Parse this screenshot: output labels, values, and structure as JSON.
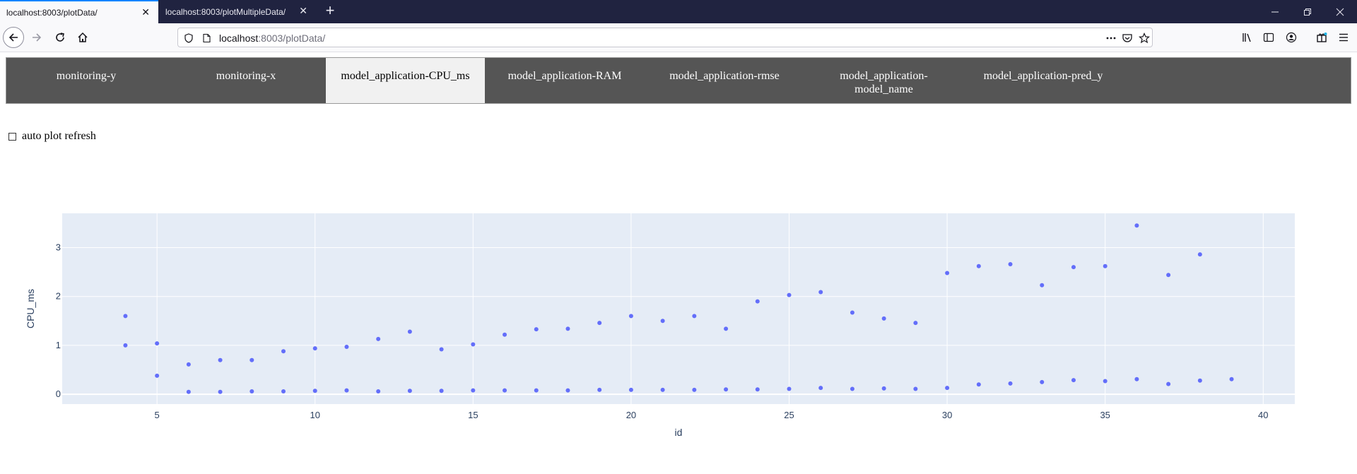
{
  "browser": {
    "tabs": [
      {
        "title": "localhost:8003/plotData/",
        "active": true
      },
      {
        "title": "localhost:8003/plotMultipleData/",
        "active": false
      }
    ],
    "address": {
      "host": "localhost",
      "rest": ":8003/plotData/"
    }
  },
  "page": {
    "tabs": [
      {
        "label": "monitoring-y",
        "active": false
      },
      {
        "label": "monitoring-x",
        "active": false
      },
      {
        "label": "model_application-CPU_ms",
        "active": true
      },
      {
        "label": "model_application-RAM",
        "active": false
      },
      {
        "label": "model_application-rmse",
        "active": false
      },
      {
        "label": "model_application-\nmodel_name",
        "active": false
      },
      {
        "label": "model_application-pred_y",
        "active": false
      }
    ],
    "auto_refresh_label": "auto plot refresh"
  },
  "colors": {
    "accent": "#0a84ff",
    "marker": "#636efa",
    "plot_bg": "#e5ecf6",
    "tab_bg": "#555555",
    "tab_active_bg": "#f1f1f1"
  },
  "chart_data": {
    "type": "scatter",
    "xlabel": "id",
    "ylabel": "CPU_ms",
    "xlim": [
      2,
      41
    ],
    "ylim": [
      -0.2,
      3.7
    ],
    "xticks": [
      5,
      10,
      15,
      20,
      25,
      30,
      35,
      40
    ],
    "yticks": [
      0,
      1,
      2,
      3
    ],
    "grid": true,
    "series": [
      {
        "points": [
          [
            4,
            1.6
          ],
          [
            4,
            1.0
          ],
          [
            5,
            1.04
          ],
          [
            5,
            0.38
          ],
          [
            6,
            0.61
          ],
          [
            6,
            0.05
          ],
          [
            7,
            0.7
          ],
          [
            7,
            0.05
          ],
          [
            8,
            0.7
          ],
          [
            8,
            0.06
          ],
          [
            9,
            0.88
          ],
          [
            9,
            0.06
          ],
          [
            10,
            0.94
          ],
          [
            10,
            0.07
          ],
          [
            11,
            0.97
          ],
          [
            11,
            0.08
          ],
          [
            12,
            1.13
          ],
          [
            12,
            0.06
          ],
          [
            13,
            1.28
          ],
          [
            13,
            0.07
          ],
          [
            14,
            0.92
          ],
          [
            14,
            0.07
          ],
          [
            15,
            1.02
          ],
          [
            15,
            0.08
          ],
          [
            16,
            1.22
          ],
          [
            16,
            0.08
          ],
          [
            17,
            1.33
          ],
          [
            17,
            0.08
          ],
          [
            18,
            1.34
          ],
          [
            18,
            0.08
          ],
          [
            19,
            1.46
          ],
          [
            19,
            0.09
          ],
          [
            20,
            1.6
          ],
          [
            20,
            0.09
          ],
          [
            21,
            1.5
          ],
          [
            21,
            0.09
          ],
          [
            22,
            1.6
          ],
          [
            22,
            0.09
          ],
          [
            23,
            1.34
          ],
          [
            23,
            0.1
          ],
          [
            24,
            1.9
          ],
          [
            24,
            0.1
          ],
          [
            25,
            2.03
          ],
          [
            25,
            0.11
          ],
          [
            26,
            2.09
          ],
          [
            26,
            0.13
          ],
          [
            27,
            1.67
          ],
          [
            27,
            0.11
          ],
          [
            28,
            1.55
          ],
          [
            28,
            0.12
          ],
          [
            29,
            1.46
          ],
          [
            29,
            0.11
          ],
          [
            30,
            2.48
          ],
          [
            30,
            0.13
          ],
          [
            31,
            2.62
          ],
          [
            31,
            0.2
          ],
          [
            32,
            2.66
          ],
          [
            32,
            0.22
          ],
          [
            33,
            2.23
          ],
          [
            33,
            0.25
          ],
          [
            34,
            2.6
          ],
          [
            34,
            0.29
          ],
          [
            35,
            2.62
          ],
          [
            35,
            0.27
          ],
          [
            36,
            3.45
          ],
          [
            36,
            0.31
          ],
          [
            37,
            2.44
          ],
          [
            37,
            0.21
          ],
          [
            38,
            2.86
          ],
          [
            38,
            0.28
          ],
          [
            39,
            0.31
          ]
        ]
      }
    ]
  }
}
